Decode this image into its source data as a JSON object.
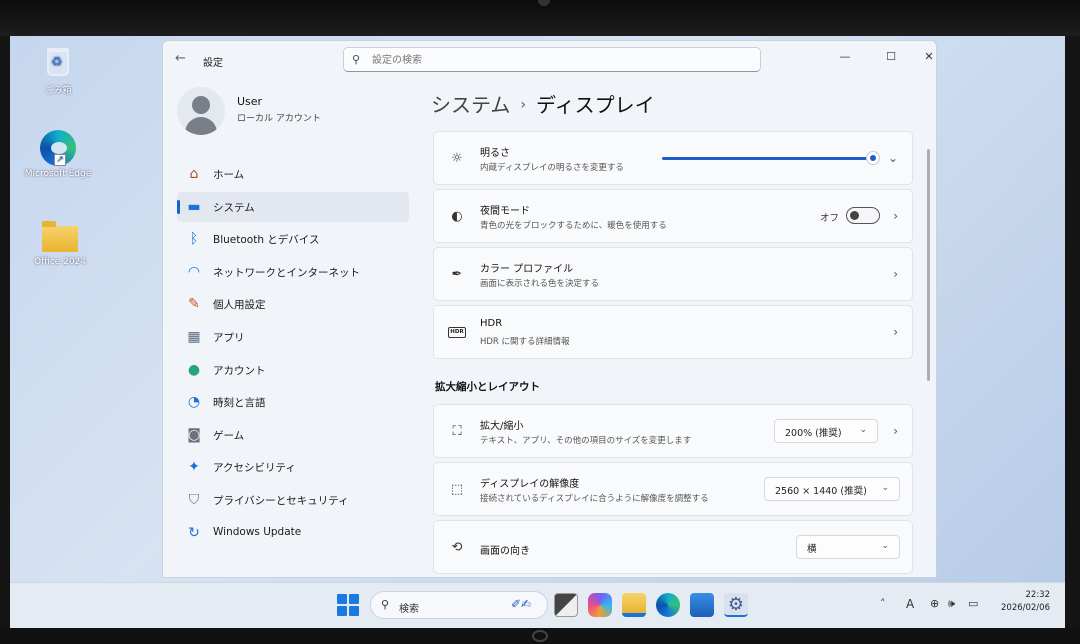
{
  "desktop": {
    "icons": [
      {
        "label": "ごみ箱"
      },
      {
        "label": "Microsoft Edge"
      },
      {
        "label": "Office 2024"
      }
    ]
  },
  "window": {
    "title": "設定",
    "search_placeholder": "設定の検索",
    "controls": {
      "minimize": "—",
      "maximize": "☐",
      "close": "✕"
    }
  },
  "user": {
    "name": "User",
    "account_type": "ローカル アカウント"
  },
  "sidebar": {
    "items": [
      {
        "label": "ホーム",
        "icon": "home-icon",
        "glyph": "⌂",
        "color": "#b04a2a"
      },
      {
        "label": "システム",
        "icon": "system-icon",
        "glyph": "▬",
        "color": "#1a73d8"
      },
      {
        "label": "Bluetooth とデバイス",
        "icon": "bluetooth-icon",
        "glyph": "ᛒ",
        "color": "#1a73d8"
      },
      {
        "label": "ネットワークとインターネット",
        "icon": "wifi-icon",
        "glyph": "◠",
        "color": "#1a73d8"
      },
      {
        "label": "個人用設定",
        "icon": "brush-icon",
        "glyph": "✎",
        "color": "#c05a2a"
      },
      {
        "label": "アプリ",
        "icon": "apps-icon",
        "glyph": "▦",
        "color": "#5a6b80"
      },
      {
        "label": "アカウント",
        "icon": "account-icon",
        "glyph": "●",
        "color": "#2aa57a"
      },
      {
        "label": "時刻と言語",
        "icon": "globe-clock-icon",
        "glyph": "◔",
        "color": "#1a73d8"
      },
      {
        "label": "ゲーム",
        "icon": "gamepad-icon",
        "glyph": "◙",
        "color": "#6a7280"
      },
      {
        "label": "アクセシビリティ",
        "icon": "accessibility-icon",
        "glyph": "✦",
        "color": "#1a73d8"
      },
      {
        "label": "プライバシーとセキュリティ",
        "icon": "shield-icon",
        "glyph": "⛉",
        "color": "#6a7280"
      },
      {
        "label": "Windows Update",
        "icon": "windows-update-icon",
        "glyph": "↻",
        "color": "#1a73d8"
      }
    ]
  },
  "breadcrumb": {
    "parent": "システム",
    "separator": "›",
    "current": "ディスプレイ"
  },
  "settings": {
    "brightness": {
      "title": "明るさ",
      "subtitle": "内蔵ディスプレイの明るさを変更する",
      "value_percent": 100
    },
    "night_light": {
      "title": "夜間モード",
      "subtitle": "青色の光をブロックするために、暖色を使用する",
      "state": "オフ"
    },
    "color_profile": {
      "title": "カラー プロファイル",
      "subtitle": "画面に表示される色を決定する"
    },
    "hdr": {
      "title": "HDR",
      "subtitle": "HDR に関する詳細情報",
      "badge": "HDR"
    },
    "section_scale": "拡大縮小とレイアウト",
    "scale": {
      "title": "拡大/縮小",
      "subtitle": "テキスト、アプリ、その他の項目のサイズを変更します",
      "value": "200% (推奨)"
    },
    "resolution": {
      "title": "ディスプレイの解像度",
      "subtitle": "接続されているディスプレイに合うように解像度を調整する",
      "value": "2560 × 1440 (推奨)"
    },
    "orientation": {
      "title": "画面の向き",
      "value": "横"
    }
  },
  "taskbar": {
    "search_label": "検索",
    "tray_ime": "A",
    "clock_time": "22:32",
    "clock_date": "2026/02/06"
  },
  "colors": {
    "accent": "#1f5fc4",
    "window_bg": "#f1f4f9",
    "card_bg": "#f9fafc"
  }
}
